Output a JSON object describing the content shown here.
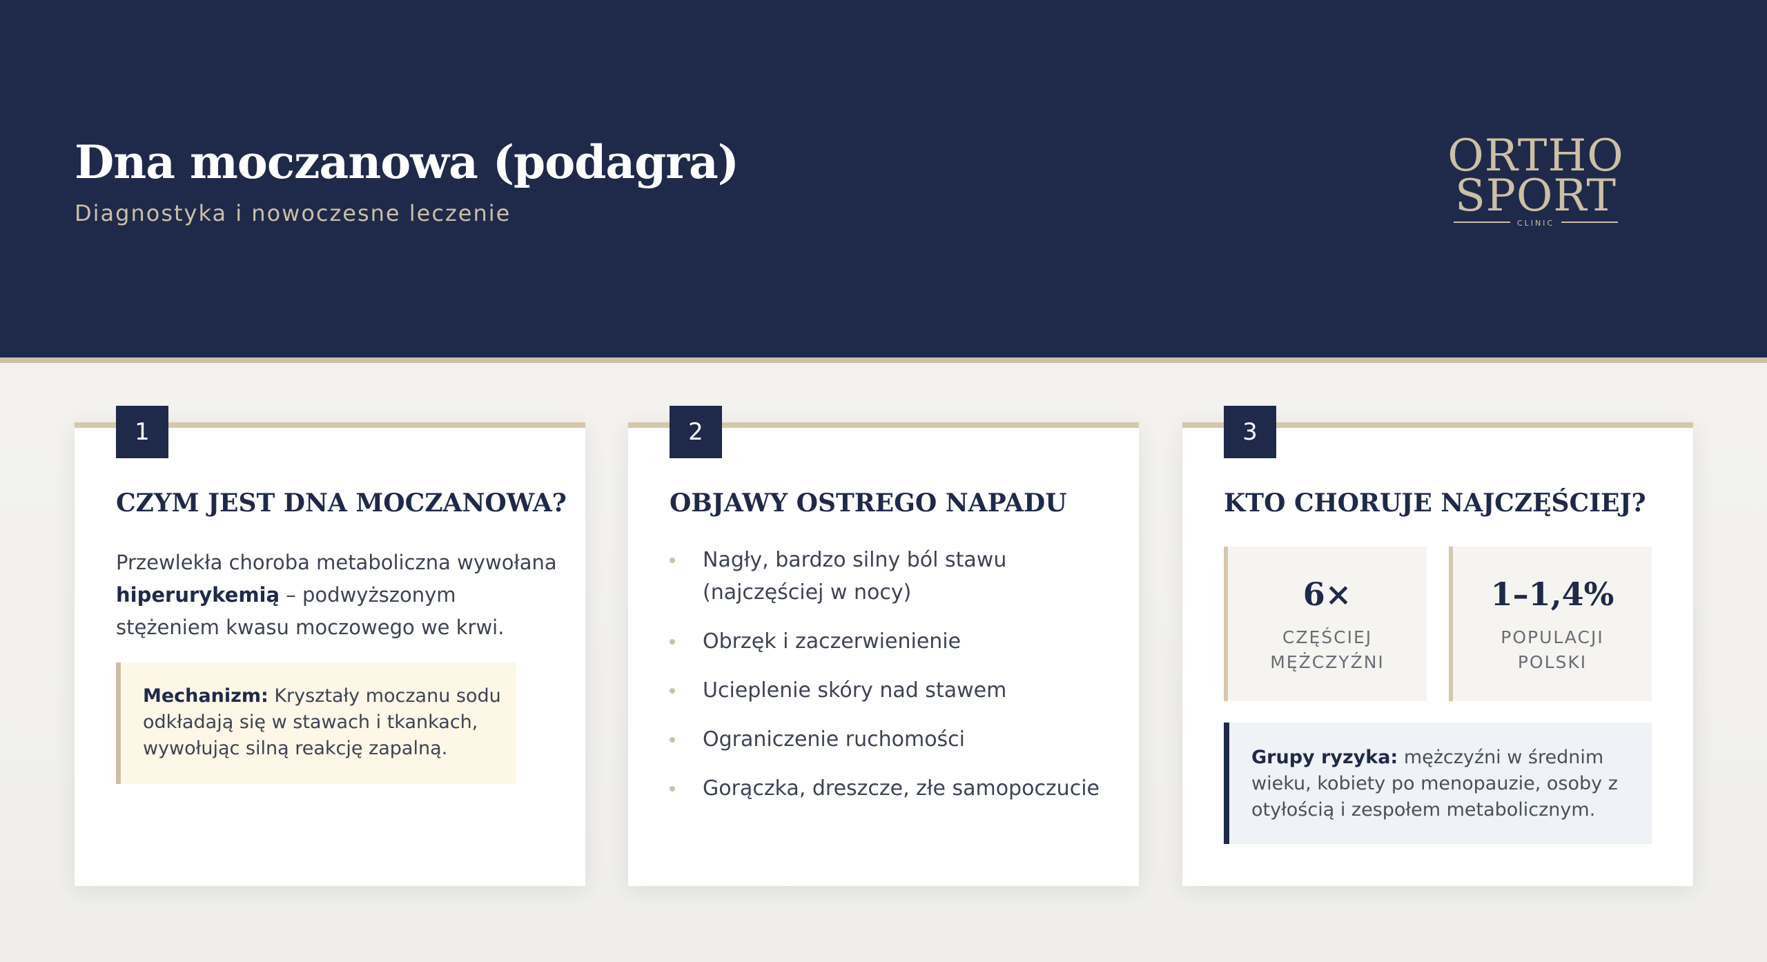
{
  "header": {
    "title": "Dna moczanowa (podagra)",
    "subtitle": "Diagnostyka i nowoczesne leczenie",
    "logo": {
      "line1": "ORTHO",
      "line2": "SPORT",
      "line3": "CLINIC"
    }
  },
  "colors": {
    "navy": "#1f2a4a",
    "beige": "#cdbfa6",
    "note_bg": "#fdf7e8",
    "risk_bg": "#eff2f6"
  },
  "cards": [
    {
      "number": "1",
      "title": "CZYM JEST DNA MOCZANOWA?",
      "body_pre": "Przewlekła choroba metaboliczna wywołana ",
      "body_strong": "hiperurykemią",
      "body_post": " – podwyższonym stężeniem kwasu moczowego we krwi.",
      "note_label": "Mechanizm:",
      "note_text": " Kryształy moczanu sodu odkładają się w stawach i tkankach, wywołując silną reakcję zapalną."
    },
    {
      "number": "2",
      "title": "OBJAWY OSTREGO NAPADU",
      "bullets": [
        "Nagły, bardzo silny ból stawu (najczęściej w nocy)",
        "Obrzęk i zaczerwienienie",
        "Ucieplenie skóry nad stawem",
        "Ograniczenie ruchomości",
        "Gorączka, dreszcze, złe samopoczucie"
      ]
    },
    {
      "number": "3",
      "title": "KTO CHORUJE NAJCZĘŚCIEJ?",
      "stats": [
        {
          "value": "6×",
          "label_line1": "CZĘŚCIEJ",
          "label_line2": "MĘŻCZYŹNI"
        },
        {
          "value": "1–1,4%",
          "label_line1": "POPULACJI",
          "label_line2": "POLSKI"
        }
      ],
      "risk_label": "Grupy ryzyka:",
      "risk_text": " mężczyźni w średnim wieku, kobiety po menopauzie, osoby z otyłością i zespołem metabolicznym."
    }
  ]
}
